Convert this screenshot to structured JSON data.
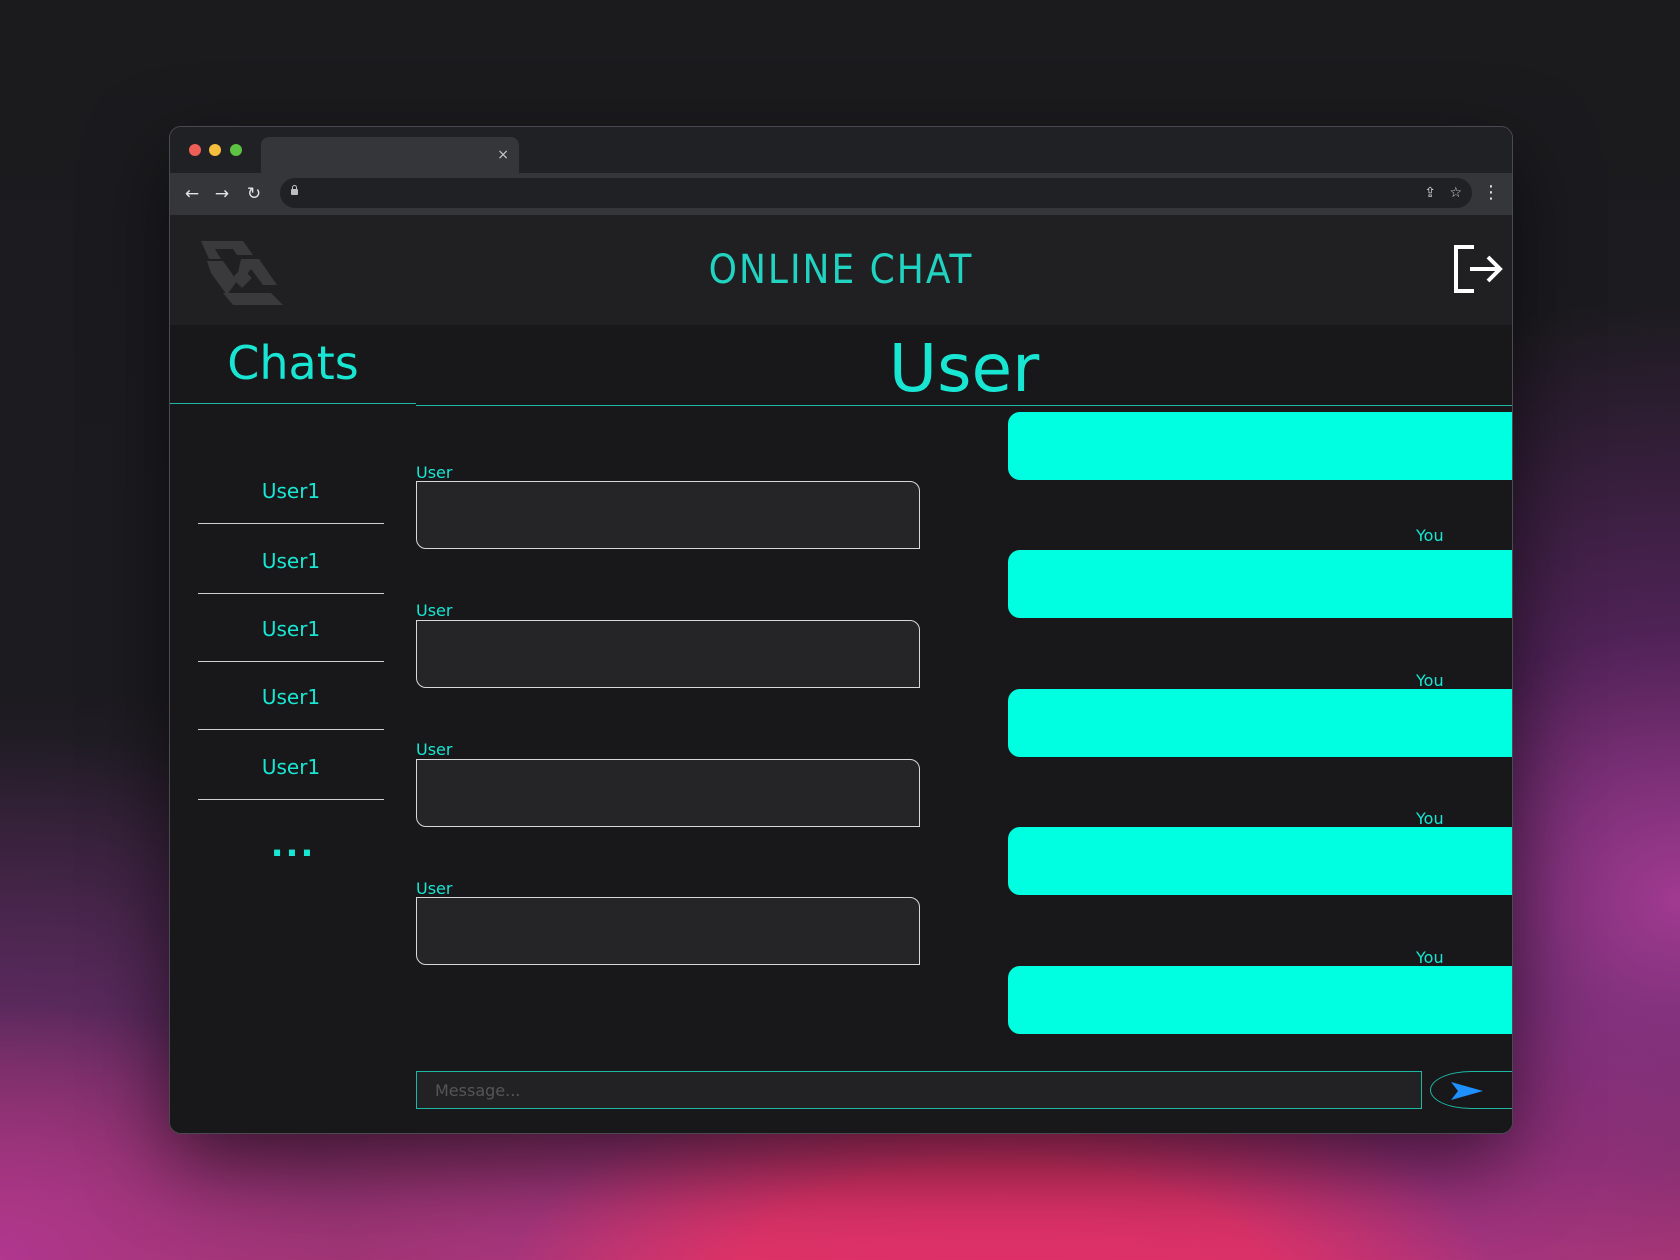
{
  "browser": {
    "tab_title": "",
    "tab_close": "×",
    "url": ""
  },
  "header": {
    "title": "ONLINE CHAT"
  },
  "sidebar": {
    "title": "Chats",
    "items": [
      {
        "label": "User1"
      },
      {
        "label": "User1"
      },
      {
        "label": "User1"
      },
      {
        "label": "User1"
      },
      {
        "label": "User1"
      }
    ],
    "more": "..."
  },
  "chat": {
    "title": "User",
    "incoming_sender": "User",
    "outgoing_sender": "You",
    "composer_placeholder": "Message..."
  },
  "colors": {
    "accent": "#18e6d3",
    "outgoing_bubble": "#00ffe0",
    "incoming_bubble": "#252527",
    "background": "#18181a",
    "send_arrow": "#1e90ff"
  }
}
